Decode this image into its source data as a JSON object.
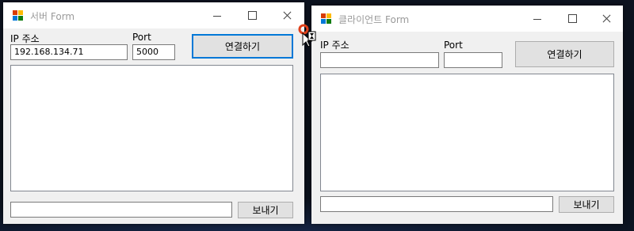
{
  "server_window": {
    "title": "서버 Form",
    "ip_label": "IP 주소",
    "ip_value": "192.168.134.71",
    "port_label": "Port",
    "port_value": "5000",
    "connect_button": "연결하기",
    "message_value": "",
    "send_button": "보내기"
  },
  "client_window": {
    "title": "클라이언트 Form",
    "ip_label": "IP 주소",
    "ip_value": "",
    "port_label": "Port",
    "port_value": "",
    "connect_button": "연결하기",
    "message_value": "",
    "send_button": "보내기"
  },
  "icons": {
    "app_icon": "windows-forms-app-icon",
    "minimize": "minimize-icon",
    "maximize": "maximize-icon",
    "close": "close-icon",
    "cursor": "busy-cursor-icon"
  },
  "colors": {
    "focus_border": "#0078d7",
    "form_background": "#f0f0f0",
    "button_background": "#e1e1e1"
  }
}
